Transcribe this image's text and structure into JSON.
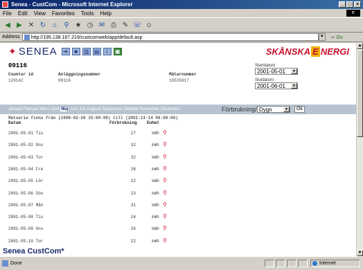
{
  "window": {
    "title": "Senea - CustCom - Microsoft Internet Explorer"
  },
  "menu": [
    "File",
    "Edit",
    "View",
    "Favorites",
    "Tools",
    "Help"
  ],
  "address": {
    "label": "Address",
    "url": "http://195.138.167.219/custcomweb/app/default.asp",
    "go": "Go"
  },
  "header": {
    "brand": "SENEA",
    "partner_left": "SKÅNSKA",
    "partner_e": "E",
    "partner_right": "NERGI"
  },
  "info": {
    "id": "09116",
    "labels": {
      "counter_id": "Counter id",
      "facility": "Anläggningsnummer",
      "meter": "Mätarnummer"
    },
    "values": {
      "counter_id": "120142",
      "facility": "09116",
      "meter": "19535917"
    },
    "start_label": "Startdatum",
    "start_value": "2001-05-01",
    "end_label": "Slutdatum",
    "end_value": "2001-06-01"
  },
  "months": [
    "Januari",
    "Februari",
    "Mars",
    "April",
    "Maj",
    "Juni",
    "Juli",
    "Augusti",
    "September",
    "Oktober",
    "November",
    "December"
  ],
  "active_month": "Maj",
  "consumption": {
    "label": "Förbrukning/",
    "period": "Dygn",
    "ok": "Ok"
  },
  "measure_text": "Mätserie finns från (1998-02-26 15:00:00) till (2001-11-14 06:00:00)",
  "table": {
    "headers": {
      "date": "Datum",
      "value": "Förbrukning",
      "unit": "Enhet"
    },
    "rows": [
      {
        "date": "2001-05-01 Tis",
        "value": "27",
        "unit": "kWh"
      },
      {
        "date": "2001-05-02 Ons",
        "value": "32",
        "unit": "kWh"
      },
      {
        "date": "2001-05-03 Tor",
        "value": "32",
        "unit": "kWh"
      },
      {
        "date": "2001-05-04 Fre",
        "value": "26",
        "unit": "kWh"
      },
      {
        "date": "2001-05-05 Lör",
        "value": "22",
        "unit": "kWh"
      },
      {
        "date": "2001-05-06 Sön",
        "value": "23",
        "unit": "kWh"
      },
      {
        "date": "2001-05-07 Mån",
        "value": "31",
        "unit": "kWh"
      },
      {
        "date": "2001-05-08 Tis",
        "value": "24",
        "unit": "kWh"
      },
      {
        "date": "2001-05-09 Ons",
        "value": "26",
        "unit": "kWh"
      },
      {
        "date": "2001-05-10 Tor",
        "value": "22",
        "unit": "kWh"
      }
    ]
  },
  "footer": "Senea CustCom*",
  "status": {
    "text": "Done",
    "zone": "Internet"
  }
}
